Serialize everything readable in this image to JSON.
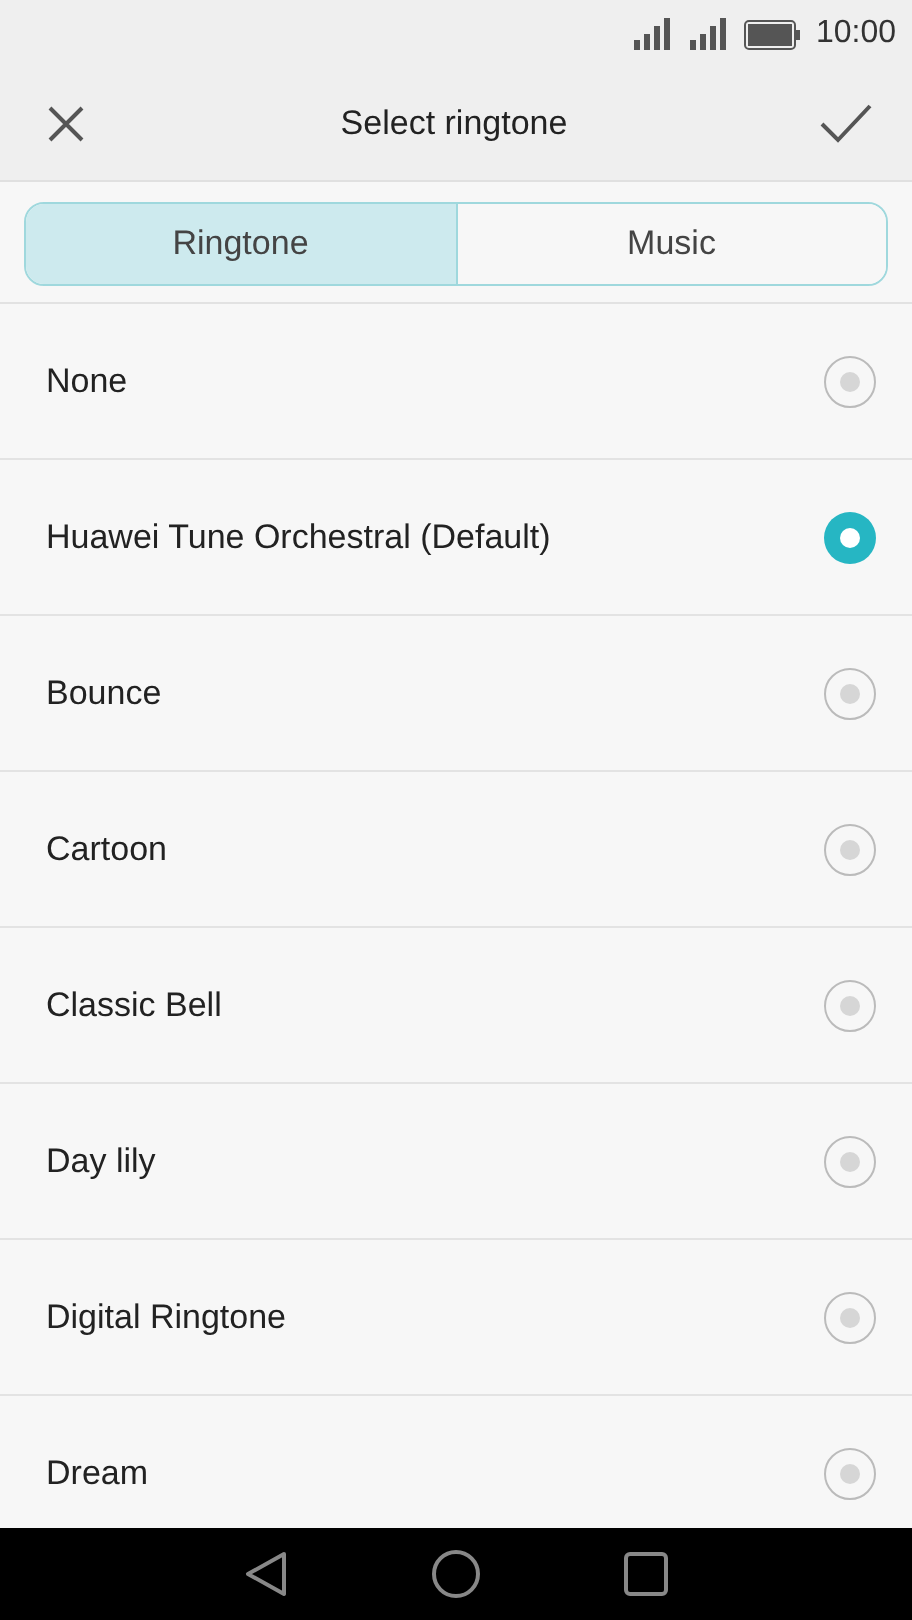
{
  "status_bar": {
    "time": "10:00"
  },
  "toolbar": {
    "title": "Select ringtone"
  },
  "tabs": [
    {
      "label": "Ringtone",
      "selected": true
    },
    {
      "label": "Music",
      "selected": false
    }
  ],
  "ringtones": [
    {
      "name": "None",
      "selected": false
    },
    {
      "name": "Huawei Tune Orchestral (Default)",
      "selected": true
    },
    {
      "name": "Bounce",
      "selected": false
    },
    {
      "name": "Cartoon",
      "selected": false
    },
    {
      "name": "Classic Bell",
      "selected": false
    },
    {
      "name": "Day lily",
      "selected": false
    },
    {
      "name": "Digital Ringtone",
      "selected": false
    },
    {
      "name": "Dream",
      "selected": false
    }
  ]
}
